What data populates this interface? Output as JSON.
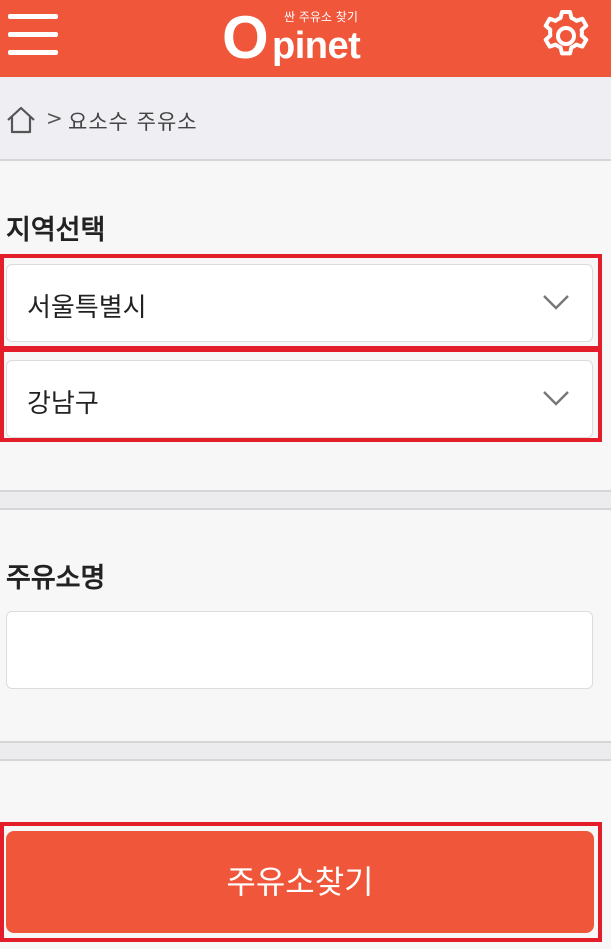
{
  "header": {
    "logo_tagline": "싼 주유소 찾기",
    "logo_o": "O",
    "logo_word": "pinet"
  },
  "breadcrumb": {
    "separator": ">",
    "current": "요소수 주유소"
  },
  "region": {
    "title": "지역선택",
    "city_value": "서울특별시",
    "district_value": "강남구"
  },
  "station": {
    "title": "주유소명",
    "name_value": "",
    "name_placeholder": ""
  },
  "actions": {
    "search_label": "주유소찾기"
  },
  "colors": {
    "brand": "#f0563a",
    "highlight": "#e41d2b",
    "background": "#f7f7f7"
  }
}
